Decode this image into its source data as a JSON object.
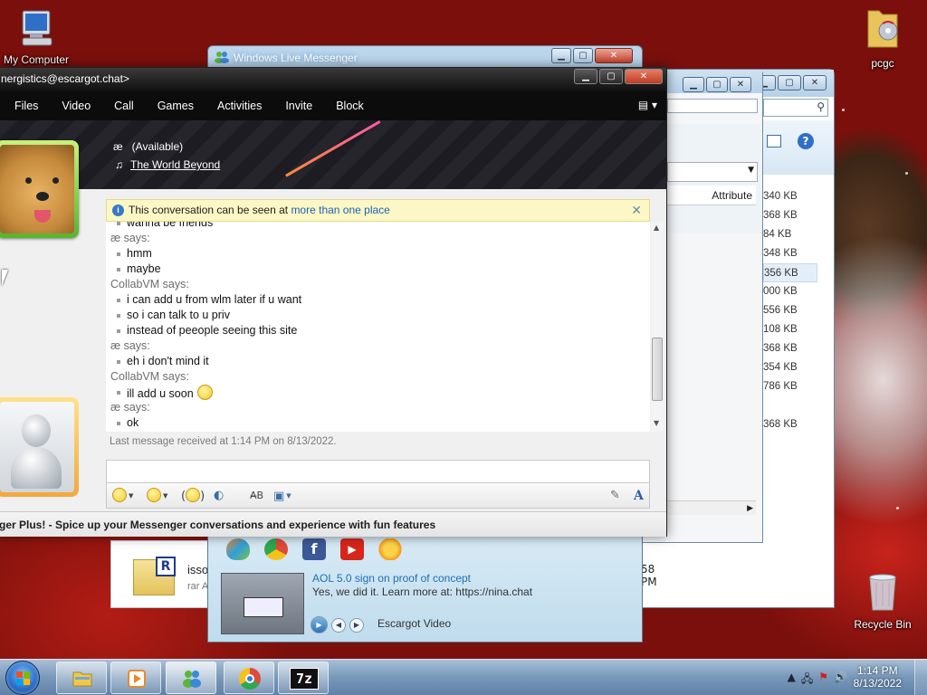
{
  "desktop": {
    "icons": {
      "my_computer": "My Computer",
      "pcgc": "pcgc",
      "recycle_bin": "Recycle Bin"
    }
  },
  "wlm_contact_list": {
    "title": "Windows Live Messenger",
    "ad_icons": [
      "butterfly-icon",
      "chrome-logo-icon",
      "facebook-icon",
      "youtube-icon",
      "sun-icon"
    ],
    "video": {
      "title": "AOL 5.0 sign on proof of concept",
      "subtitle": "Yes, we did it. Learn more at: https://nina.chat",
      "label": "Escargot Video"
    }
  },
  "explorer": {
    "column_header": "Attribute",
    "sizes": [
      "340 KB",
      "368 KB",
      "84 KB",
      "348 KB",
      "356 KB",
      "000 KB",
      "556 KB",
      "108 KB",
      "368 KB",
      "354 KB",
      "786 KB",
      "",
      "368 KB"
    ],
    "selected_index": 4,
    "file": {
      "name": "isso",
      "type": "rar A",
      "time": "58 PM"
    }
  },
  "conversation": {
    "title": "nergistics@escargot.chat>",
    "menu": [
      "Files",
      "Video",
      "Call",
      "Games",
      "Activities",
      "Invite",
      "Block"
    ],
    "contact": {
      "name": "æ",
      "status": "(Available)",
      "now_playing": "The World Beyond"
    },
    "notice": {
      "text": "This conversation can be seen at ",
      "link": "more than one place"
    },
    "history_cut_line": "wanna be friends",
    "history": [
      {
        "kind": "sender",
        "text": "æ says:"
      },
      {
        "kind": "msg",
        "text": "hmm"
      },
      {
        "kind": "msg",
        "text": "maybe"
      },
      {
        "kind": "sender",
        "text": "CollabVM says:"
      },
      {
        "kind": "msg",
        "text": "i can add u from wlm later if u want"
      },
      {
        "kind": "msg",
        "text": "so i can talk to u priv"
      },
      {
        "kind": "msg",
        "text": "instead of peeople seeing this site"
      },
      {
        "kind": "sender",
        "text": "æ says:"
      },
      {
        "kind": "msg",
        "text": "eh i don't mind it"
      },
      {
        "kind": "sender",
        "text": "CollabVM says:"
      },
      {
        "kind": "msg",
        "text": "ill add u soon",
        "emoticon": true
      },
      {
        "kind": "sender",
        "text": "æ says:"
      },
      {
        "kind": "msg",
        "text": "ok"
      }
    ],
    "last_message": "Last message received at 1:14 PM on 8/13/2022.",
    "ad_text": "ger Plus! - Spice up your Messenger conversations and experience with fun features"
  },
  "taskbar": {
    "time": "1:14 PM",
    "date": "8/13/2022",
    "buttons": [
      "explorer-icon",
      "media-player-icon",
      "messenger-icon",
      "chrome-icon",
      "7zip-icon"
    ],
    "zip_label": "7z"
  },
  "colors": {
    "link": "#1a63b8",
    "notice_bg": "#fcf7c5",
    "menubar_bg": "#0c0c0c"
  }
}
